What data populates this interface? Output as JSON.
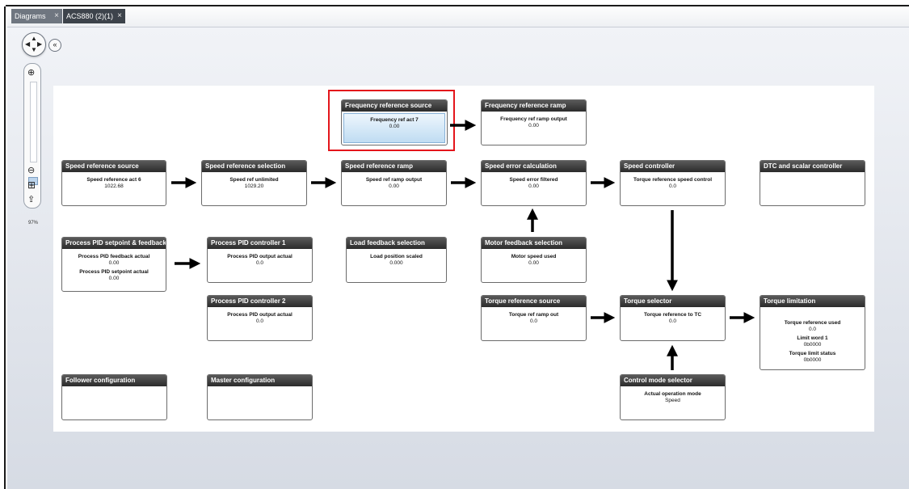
{
  "tabs": [
    {
      "label": "Diagrams",
      "close": "×"
    },
    {
      "label": "ACS880 (2)(1)",
      "close": "×"
    }
  ],
  "navigation": {
    "zoom_percent": "97%",
    "pan_up": "▲",
    "pan_down": "▼",
    "pan_left": "◀",
    "pan_right": "▶",
    "collapse": "«",
    "zoom_in": "⊕",
    "zoom_out": "⊖",
    "fit": "⊞",
    "export": "⇪"
  },
  "blocks": {
    "freq_source": {
      "title": "Frequency reference source",
      "lines": [
        {
          "label": "Frequency ref act 7",
          "value": "0.00"
        }
      ]
    },
    "freq_ramp": {
      "title": "Frequency reference ramp",
      "lines": [
        {
          "label": "Frequency ref ramp output",
          "value": "0.00"
        }
      ]
    },
    "speed_source": {
      "title": "Speed reference source",
      "lines": [
        {
          "label": "Speed reference act 6",
          "value": "1022.68"
        }
      ]
    },
    "speed_selection": {
      "title": "Speed reference selection",
      "lines": [
        {
          "label": "Speed ref unlimited",
          "value": "1029.20"
        }
      ]
    },
    "speed_ramp": {
      "title": "Speed reference ramp",
      "lines": [
        {
          "label": "Speed ref ramp output",
          "value": "0.00"
        }
      ]
    },
    "speed_error": {
      "title": "Speed error calculation",
      "lines": [
        {
          "label": "Speed error filtered",
          "value": "0.00"
        }
      ]
    },
    "speed_controller": {
      "title": "Speed controller",
      "lines": [
        {
          "label": "Torque reference speed control",
          "value": "0.0"
        }
      ]
    },
    "dtc": {
      "title": "DTC and scalar controller",
      "lines": []
    },
    "pid_setpoint": {
      "title": "Process PID setpoint & feedback",
      "lines": [
        {
          "label": "Process PID feedback actual",
          "value": "0.00"
        },
        {
          "label": "Process PID setpoint actual",
          "value": "0.00"
        }
      ]
    },
    "pid_controller1": {
      "title": "Process PID controller 1",
      "lines": [
        {
          "label": "Process PID output actual",
          "value": "0.0"
        }
      ]
    },
    "load_feedback": {
      "title": "Load feedback selection",
      "lines": [
        {
          "label": "Load position scaled",
          "value": "0.000"
        }
      ]
    },
    "motor_feedback": {
      "title": "Motor feedback selection",
      "lines": [
        {
          "label": "Motor speed used",
          "value": "0.00"
        }
      ]
    },
    "pid_controller2": {
      "title": "Process PID controller 2",
      "lines": [
        {
          "label": "Process PID output actual",
          "value": "0.0"
        }
      ]
    },
    "torque_source": {
      "title": "Torque reference source",
      "lines": [
        {
          "label": "Torque ref ramp out",
          "value": "0.0"
        }
      ]
    },
    "torque_selector": {
      "title": "Torque selector",
      "lines": [
        {
          "label": "Torque reference to TC",
          "value": "0.0"
        }
      ]
    },
    "torque_limitation": {
      "title": "Torque limitation",
      "lines": [
        {
          "label": "Torque reference used",
          "value": "0.0"
        },
        {
          "label": "Limit word 1",
          "value": "0b0000"
        },
        {
          "label": "Torque limit status",
          "value": "0b0000"
        }
      ]
    },
    "follower": {
      "title": "Follower configuration",
      "lines": []
    },
    "master": {
      "title": "Master configuration",
      "lines": []
    },
    "control_mode": {
      "title": "Control mode selector",
      "lines": [
        {
          "label": "Actual operation mode",
          "value": "Speed"
        }
      ]
    }
  },
  "colors": {
    "header_bg": "#2b2b2b",
    "highlight": "#e4151b",
    "selected_fill": "#bfdcf2",
    "workspace": "#d6dbe4"
  }
}
